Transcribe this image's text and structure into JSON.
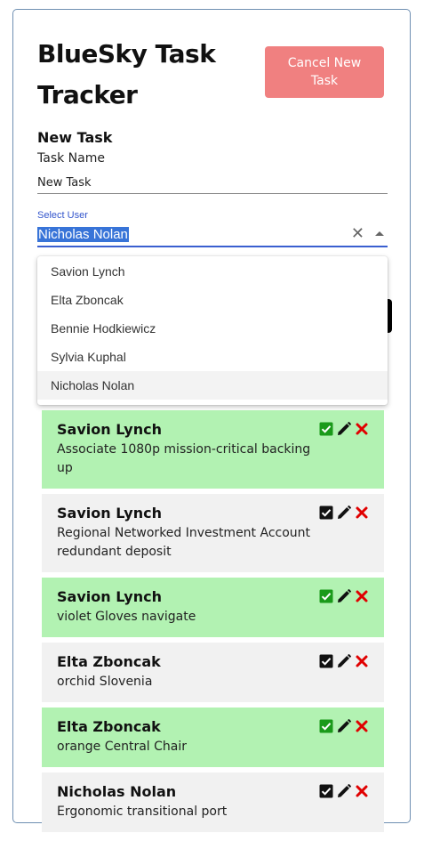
{
  "app": {
    "title": "BlueSky Task Tracker"
  },
  "header": {
    "cancel_label": "Cancel New Task"
  },
  "form": {
    "heading": "New Task",
    "task_name_label": "Task Name",
    "task_name_value": "New Task",
    "select_user_label": "Select User",
    "selected_user": "Nicholas Nolan"
  },
  "dropdown": {
    "options": [
      "Savion Lynch",
      "Elta Zboncak",
      "Bennie Hodkiewicz",
      "Sylvia Kuphal",
      "Nicholas Nolan"
    ]
  },
  "tasks": [
    {
      "user": "Savion Lynch",
      "description": "Associate 1080p mission-critical backing up",
      "completed": true
    },
    {
      "user": "Savion Lynch",
      "description": "Regional Networked Investment Account redundant deposit",
      "completed": false
    },
    {
      "user": "Savion Lynch",
      "description": "violet Gloves navigate",
      "completed": true
    },
    {
      "user": "Elta Zboncak",
      "description": "orchid Slovenia",
      "completed": false
    },
    {
      "user": "Elta Zboncak",
      "description": "orange Central Chair",
      "completed": true
    },
    {
      "user": "Nicholas Nolan",
      "description": "Ergonomic transitional port",
      "completed": false
    }
  ],
  "icons": {
    "complete": "check-square-icon",
    "edit": "pencil-icon",
    "delete": "x-icon"
  },
  "colors": {
    "done_bg": "#b2f2b2",
    "todo_bg": "#f1f1f1",
    "cancel_bg": "#f08080",
    "accent": "#3a5fd0",
    "check_done": "#1a9a1a",
    "delete": "#e00000"
  }
}
